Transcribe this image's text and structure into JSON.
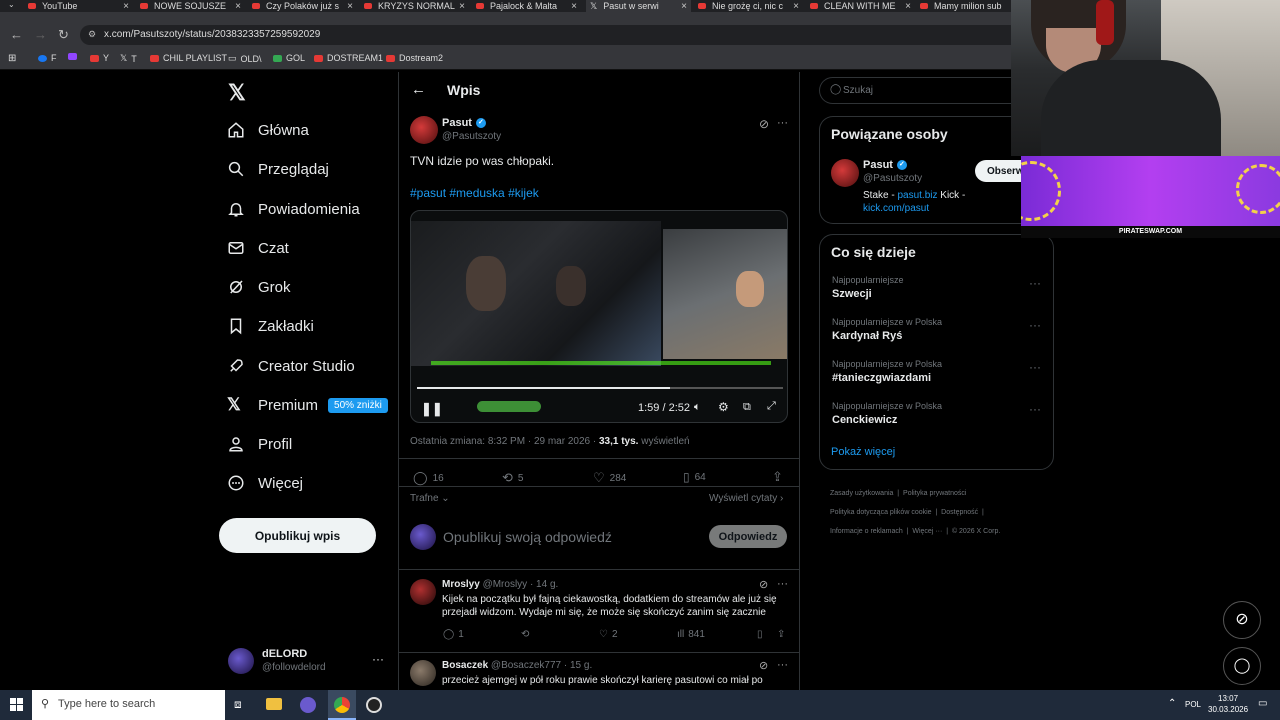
{
  "browser": {
    "tabs": [
      "YouTube",
      "NOWE SOJUSZE",
      "Czy Polaków już s",
      "KRYZYS NORMAL",
      "Pajalock & Malta",
      "Pasut w serwi",
      "Nie grożę ci, nic c",
      "CLEAN WITH ME",
      "Mamy milion sub"
    ],
    "url": "x.com/Pasutszoty/status/2038323357259592029",
    "bookmarks": [
      "F",
      "Y",
      "T",
      "CHIL PLAYLIST",
      "OLD\\",
      "GOL",
      "DOSTREAM1",
      "Dostream2"
    ]
  },
  "nav": {
    "items": [
      "Główna",
      "Przeglądaj",
      "Powiadomienia",
      "Czat",
      "Grok",
      "Zakładki",
      "Creator Studio",
      "Premium",
      "Profil",
      "Więcej"
    ],
    "premium_badge": "50% zniżki",
    "publish_label": "Opublikuj wpis",
    "account_name": "dELORD",
    "account_handle": "@followdelord"
  },
  "post": {
    "header_title": "Wpis",
    "author": "Pasut",
    "handle": "@Pasutszoty",
    "text": "TVN idzie po was chłopaki.",
    "hashtags": "#pasut #meduska #kijek",
    "video_time": "1:59 / 2:52",
    "meta_prefix": "Ostatnia zmiana: 8:32 PM · 29 mar 2026 · ",
    "views_count": "33,1 tys.",
    "views_label": "wyświetleń",
    "replies": "16",
    "reposts": "5",
    "likes": "284",
    "bookmarks": "64",
    "sort_label": "Trafne",
    "quotes_label": "Wyświetl cytaty",
    "reply_placeholder": "Opublikuj swoją odpowiedź",
    "reply_button": "Odpowiedz"
  },
  "replies": [
    {
      "author": "Mroslyy",
      "handle": "@Mroslyy · 14 g.",
      "text": "Kijek na początku był fajną ciekawostką, dodatkiem do streamów ale już się przejadł widzom. Wydaje mi się, że może się skończyć zanim się zacznie",
      "replies": "1",
      "reposts": "",
      "likes": "2",
      "views": "841"
    },
    {
      "author": "Bosaczek",
      "handle": "@Bosaczek777 · 15 g.",
      "text": "przecież ajemgej w pół roku prawie skończył karierę pasutowi co miał po"
    }
  ],
  "right": {
    "search_placeholder": "Szukaj",
    "related_title": "Powiązane osoby",
    "related_name": "Pasut",
    "related_handle": "@Pasutszoty",
    "related_bio_1": "Stake - ",
    "related_bio_link1": "pasut.biz",
    "related_bio_2": " Kick - ",
    "related_bio_link2": "kick.com/pasut",
    "follow_label": "Obserw",
    "trends_title": "Co się dzieje",
    "trends": [
      {
        "category": "Najpopularniejsze",
        "name": "Szwecji"
      },
      {
        "category": "Najpopularniejsze w Polska",
        "name": "Kardynał Ryś"
      },
      {
        "category": "Najpopularniejsze w Polska",
        "name": "#tanieczgwiazdami"
      },
      {
        "category": "Najpopularniejsze w Polska",
        "name": "Cenckiewicz"
      }
    ],
    "show_more": "Pokaż więcej",
    "footer": [
      "Zasady użytkowania",
      "Polityka prywatności",
      "Polityka dotycząca plików cookie",
      "Dostępność",
      "Informacje o reklamach",
      "Więcej ···",
      "© 2026 X Corp."
    ]
  },
  "overlay": {
    "banner": "PIRATESWAP.COM"
  },
  "taskbar": {
    "search_placeholder": "Type here to search",
    "lang": "POL",
    "time": "13:07",
    "date": "30.03.2026"
  }
}
